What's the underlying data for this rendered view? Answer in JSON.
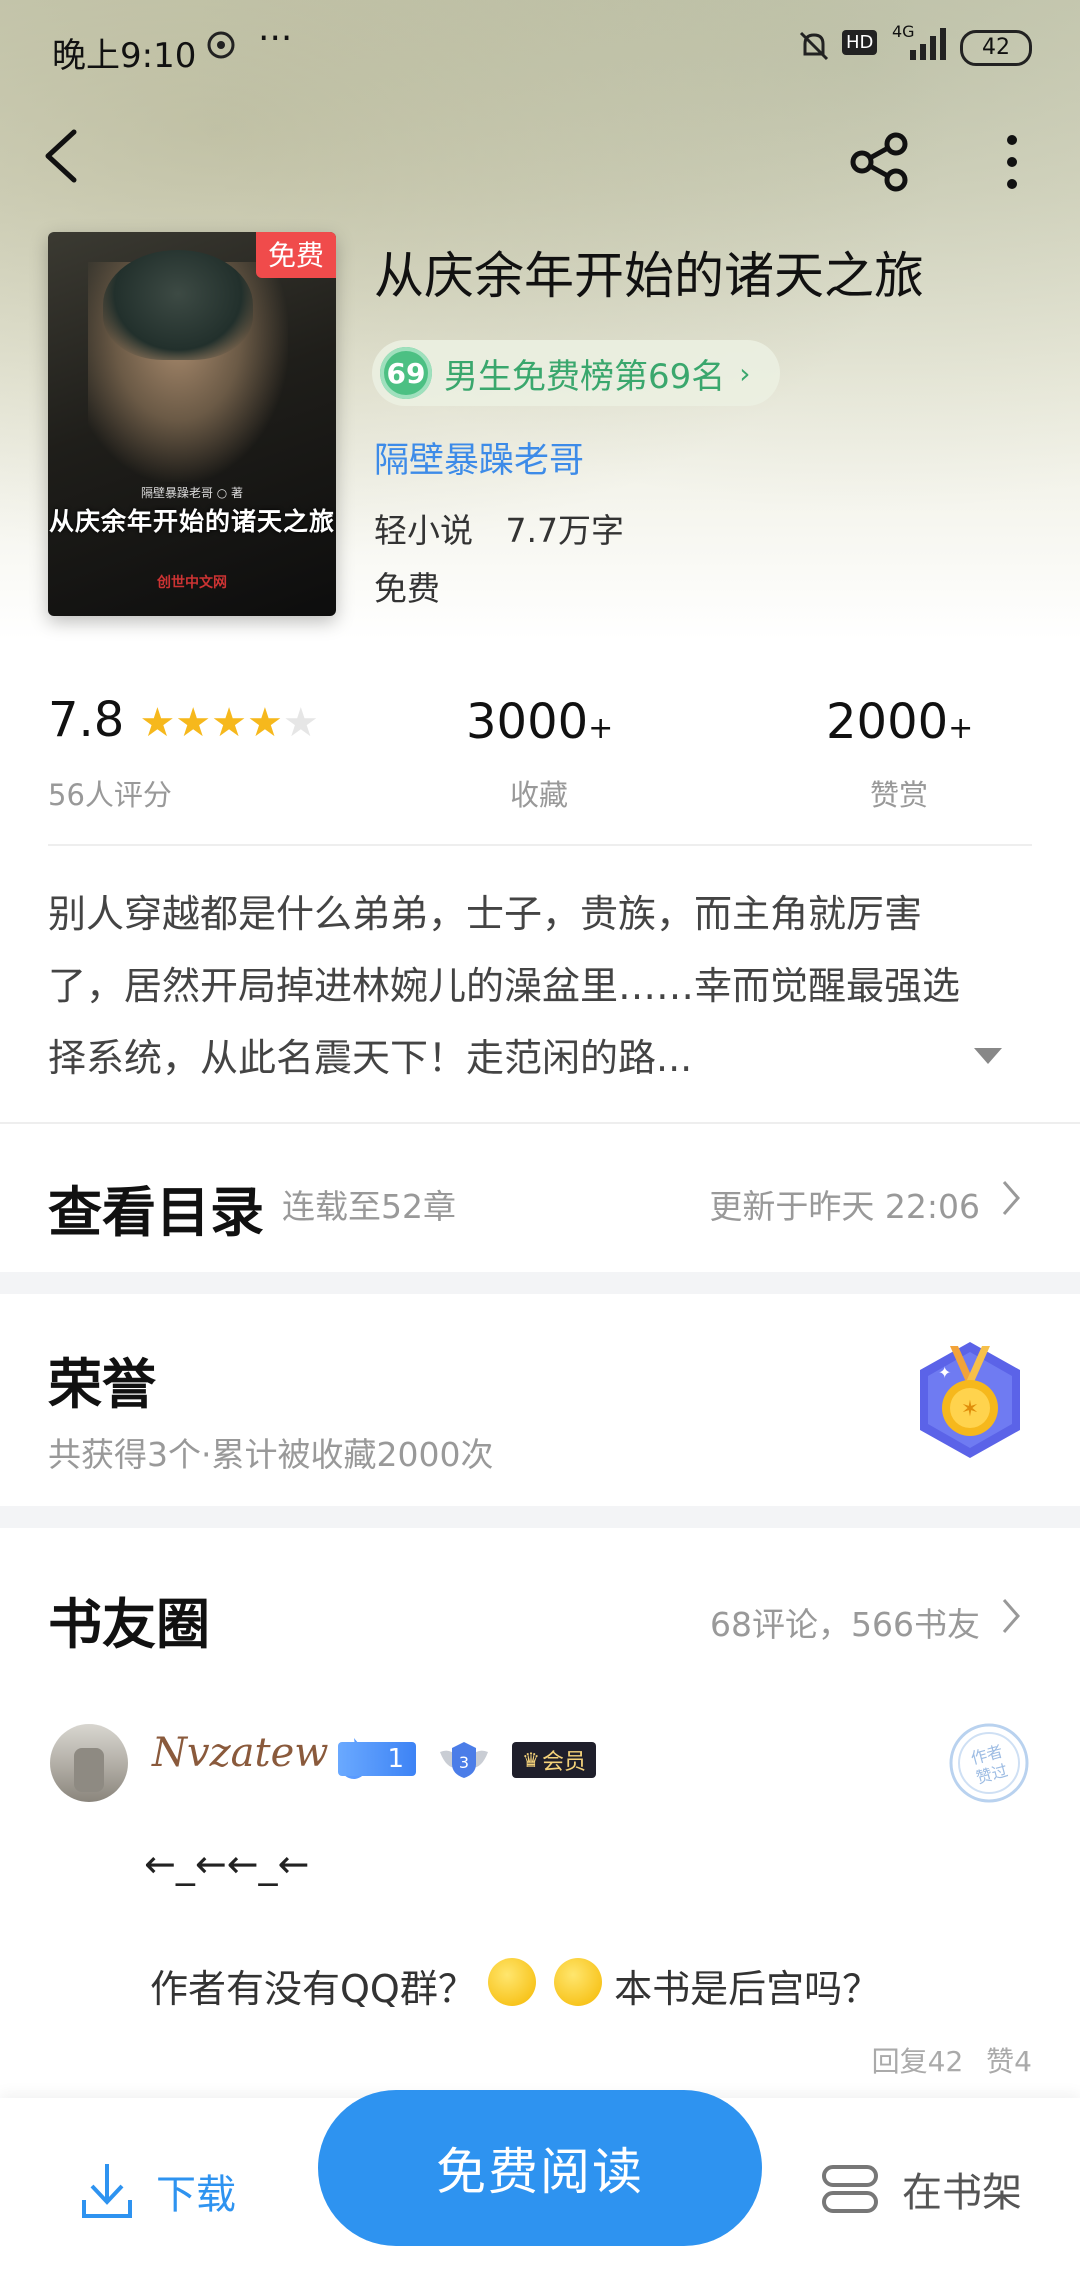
{
  "status_bar": {
    "time": "晚上9:10",
    "battery": "42",
    "network": "4G",
    "hd": "HD"
  },
  "book": {
    "title": "从庆余年开始的诸天之旅",
    "free_tag": "免费",
    "cover_title": "从庆余年开始的诸天之旅",
    "cover_author": "隔壁暴躁老哥 ○ 著",
    "cover_publisher": "创世中文网",
    "rank_number": "69",
    "rank_text": "男生免费榜第69名",
    "author": "隔壁暴躁老哥",
    "category": "轻小说",
    "word_count": "7.7万字",
    "price": "免费"
  },
  "stats": {
    "rating": "7.8",
    "stars": 4,
    "rating_count": "56人评分",
    "favorites": "3000",
    "favorites_suffix": "+",
    "favorites_label": "收藏",
    "rewards": "2000",
    "rewards_suffix": "+",
    "rewards_label": "赞赏"
  },
  "description": {
    "line1": "别人穿越都是什么弟弟，士子，贵族，而主角就厉害",
    "line2": "了，居然开局掉进林婉儿的澡盆里……幸而觉醒最强选",
    "line3": "择系统，从此名震天下！走范闲的路..."
  },
  "toc": {
    "title": "查看目录",
    "progress": "连载至52章",
    "updated": "更新于昨天 22:06"
  },
  "honor": {
    "title": "荣誉",
    "summary": "共获得3个·累计被收藏2000次"
  },
  "circle": {
    "title": "书友圈",
    "summary": "68评论，566书友",
    "post": {
      "username": "Nvzatew",
      "level": "1",
      "badge_level": "3",
      "member": "会员",
      "line1": "←_←←_←",
      "line2_a": "作者有没有QQ群？",
      "line2_b": "本书是后宫吗？",
      "stamp": "作者赞过",
      "replies": "回复42",
      "likes": "赞4"
    }
  },
  "bottom": {
    "download": "下载",
    "read": "免费阅读",
    "shelf": "在书架"
  },
  "colors": {
    "accent": "#2e93f0",
    "rank_green": "#3aa76d",
    "free_red": "#f04b4b",
    "star": "#f6b81c"
  }
}
